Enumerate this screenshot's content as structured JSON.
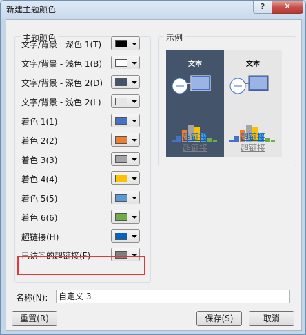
{
  "window": {
    "title": "新建主题颜色",
    "help_label": "?",
    "close_label": "✕"
  },
  "theme_colors": {
    "group_title": "主题颜色",
    "rows": [
      {
        "label": "文字/背景 - 深色 1(T)",
        "color": "#000000"
      },
      {
        "label": "文字/背景 - 浅色 1(B)",
        "color": "#ffffff"
      },
      {
        "label": "文字/背景 - 深色 2(D)",
        "color": "#44546a"
      },
      {
        "label": "文字/背景 - 浅色 2(L)",
        "color": "#e7e6e6"
      },
      {
        "label": "着色 1(1)",
        "color": "#4472c4"
      },
      {
        "label": "着色 2(2)",
        "color": "#ed7d31"
      },
      {
        "label": "着色 3(3)",
        "color": "#a5a5a5"
      },
      {
        "label": "着色 4(4)",
        "color": "#ffc000"
      },
      {
        "label": "着色 5(5)",
        "color": "#5b9bd5"
      },
      {
        "label": "着色 6(6)",
        "color": "#70ad47"
      },
      {
        "label": "超链接(H)",
        "color": "#0563c1"
      },
      {
        "label": "已访问的超链接(F)",
        "color": "#7f7f7f"
      }
    ]
  },
  "sample": {
    "group_title": "示例",
    "dark": {
      "heading": "文本",
      "hyperlink": "超链接",
      "visited": "超链接"
    },
    "light": {
      "heading": "文本",
      "hyperlink": "超链接",
      "visited": "超链接"
    }
  },
  "name_field": {
    "label": "名称(N):",
    "value": "自定义 3"
  },
  "buttons": {
    "reset": "重置(R)",
    "save": "保存(S)",
    "cancel": "取消"
  }
}
